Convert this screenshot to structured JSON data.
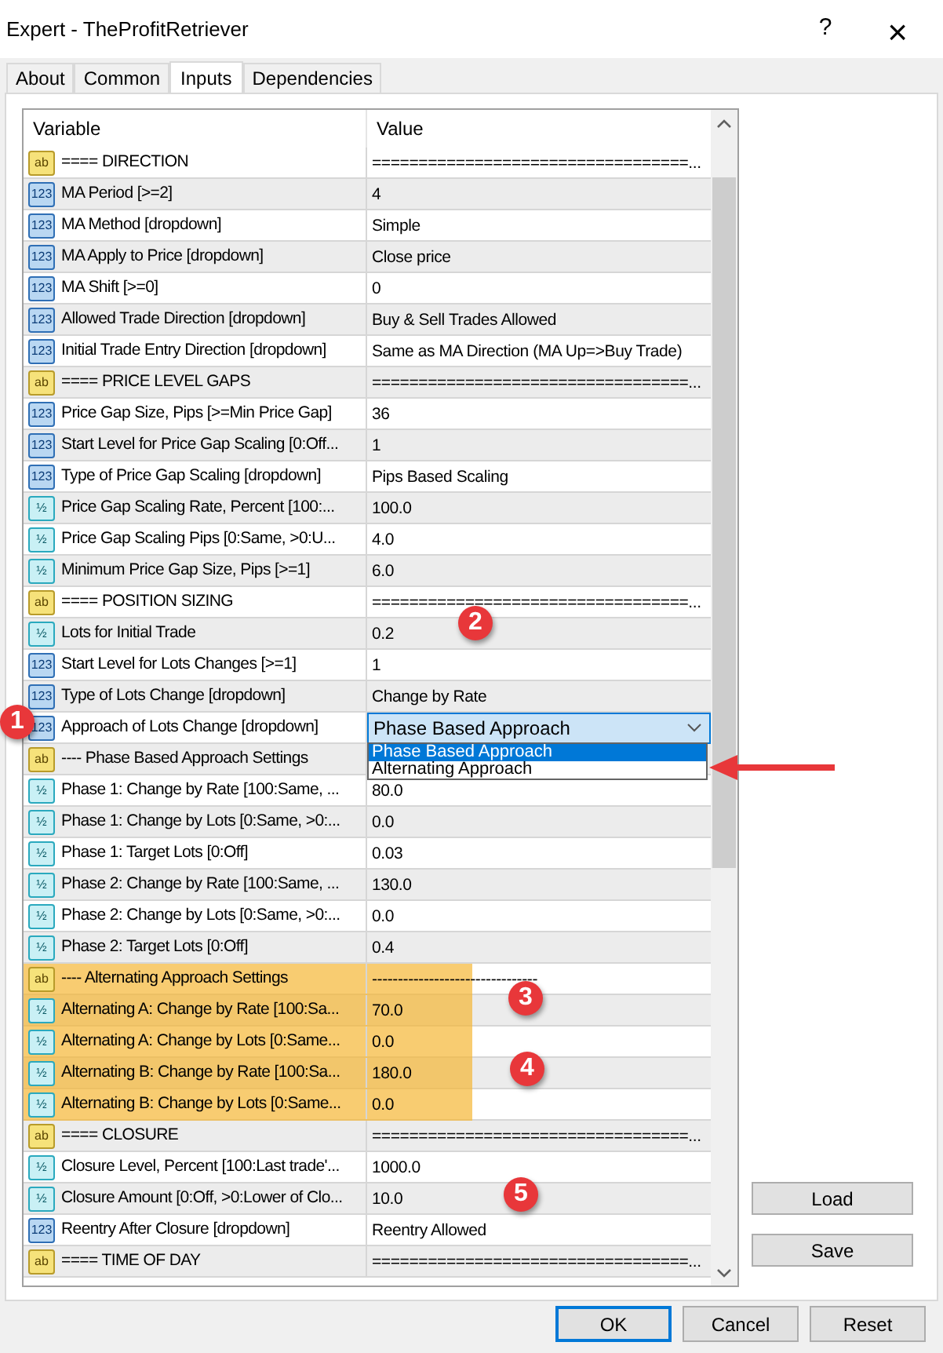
{
  "window": {
    "title": "Expert - TheProfitRetriever",
    "help": "?",
    "close": "×"
  },
  "tabs": [
    {
      "label": "About",
      "selected": false
    },
    {
      "label": "Common",
      "selected": false
    },
    {
      "label": "Inputs",
      "selected": true
    },
    {
      "label": "Dependencies",
      "selected": false
    }
  ],
  "table": {
    "columns": [
      "Variable",
      "Value"
    ],
    "rows": [
      {
        "kind": "string",
        "icon": "ab",
        "variable": "==== DIRECTION",
        "value": "==================================..."
      },
      {
        "kind": "int",
        "icon": "123",
        "variable": "MA Period [>=2]",
        "value": "4"
      },
      {
        "kind": "int",
        "icon": "123",
        "variable": "MA Method [dropdown]",
        "value": "Simple"
      },
      {
        "kind": "int",
        "icon": "123",
        "variable": "MA Apply to Price [dropdown]",
        "value": "Close price"
      },
      {
        "kind": "int",
        "icon": "123",
        "variable": "MA Shift [>=0]",
        "value": "0"
      },
      {
        "kind": "int",
        "icon": "123",
        "variable": "Allowed Trade Direction [dropdown]",
        "value": "Buy & Sell Trades Allowed"
      },
      {
        "kind": "int",
        "icon": "123",
        "variable": "Initial Trade Entry Direction [dropdown]",
        "value": "Same as MA Direction (MA Up=>Buy Trade)"
      },
      {
        "kind": "string",
        "icon": "ab",
        "variable": "==== PRICE LEVEL GAPS",
        "value": "==================================..."
      },
      {
        "kind": "int",
        "icon": "123",
        "variable": "Price Gap Size, Pips [>=Min Price Gap]",
        "value": "36"
      },
      {
        "kind": "int",
        "icon": "123",
        "variable": "Start Level for Price Gap Scaling [0:Off...",
        "value": "1"
      },
      {
        "kind": "int",
        "icon": "123",
        "variable": "Type of Price Gap Scaling [dropdown]",
        "value": "Pips Based Scaling"
      },
      {
        "kind": "double",
        "icon": "½",
        "variable": "Price Gap Scaling Rate, Percent [100:...",
        "value": "100.0"
      },
      {
        "kind": "double",
        "icon": "½",
        "variable": "Price Gap Scaling Pips [0:Same, >0:U...",
        "value": "4.0"
      },
      {
        "kind": "double",
        "icon": "½",
        "variable": "Minimum Price Gap Size, Pips [>=1]",
        "value": "6.0"
      },
      {
        "kind": "string",
        "icon": "ab",
        "variable": "==== POSITION SIZING",
        "value": "==================================..."
      },
      {
        "kind": "double",
        "icon": "½",
        "variable": "Lots for Initial Trade",
        "value": "0.2"
      },
      {
        "kind": "int",
        "icon": "123",
        "variable": "Start Level for Lots Changes [>=1]",
        "value": "1"
      },
      {
        "kind": "int",
        "icon": "123",
        "variable": "Type of Lots Change [dropdown]",
        "value": "Change by Rate"
      },
      {
        "kind": "int",
        "icon": "123",
        "variable": "Approach of Lots Change [dropdown]",
        "value": "Phase Based Approach",
        "dropdown": {
          "options": [
            {
              "label": "Phase Based Approach",
              "selected": true
            },
            {
              "label": "Alternating Approach",
              "selected": false
            }
          ]
        }
      },
      {
        "kind": "string",
        "icon": "ab",
        "variable": "---- Phase Based Approach Settings"
      },
      {
        "kind": "double",
        "icon": "½",
        "variable": "Phase 1: Change by Rate [100:Same, ...",
        "value": "80.0"
      },
      {
        "kind": "double",
        "icon": "½",
        "variable": "Phase 1: Change by Lots [0:Same, >0:...",
        "value": "0.0"
      },
      {
        "kind": "double",
        "icon": "½",
        "variable": "Phase 1: Target Lots [0:Off]",
        "value": "0.03"
      },
      {
        "kind": "double",
        "icon": "½",
        "variable": "Phase 2: Change by Rate [100:Same, ...",
        "value": "130.0"
      },
      {
        "kind": "double",
        "icon": "½",
        "variable": "Phase 2: Change by Lots [0:Same, >0:...",
        "value": "0.0"
      },
      {
        "kind": "double",
        "icon": "½",
        "variable": "Phase 2: Target Lots [0:Off]",
        "value": "0.4"
      },
      {
        "kind": "string",
        "icon": "ab",
        "variable": "---- Alternating Approach Settings",
        "value": "--------------------------------",
        "highlighted": true
      },
      {
        "kind": "double",
        "icon": "½",
        "variable": "Alternating A: Change by Rate [100:Sa...",
        "value": "70.0",
        "highlighted": true
      },
      {
        "kind": "double",
        "icon": "½",
        "variable": "Alternating A: Change by Lots [0:Same...",
        "value": "0.0",
        "highlighted": true
      },
      {
        "kind": "double",
        "icon": "½",
        "variable": "Alternating B: Change by Rate [100:Sa...",
        "value": "180.0",
        "highlighted": true
      },
      {
        "kind": "double",
        "icon": "½",
        "variable": "Alternating B: Change by Lots [0:Same...",
        "value": "0.0",
        "highlighted": true
      },
      {
        "kind": "string",
        "icon": "ab",
        "variable": "==== CLOSURE",
        "value": "==================================..."
      },
      {
        "kind": "double",
        "icon": "½",
        "variable": "Closure Level, Percent [100:Last trade'...",
        "value": "1000.0"
      },
      {
        "kind": "double",
        "icon": "½",
        "variable": "Closure Amount [0:Off, >0:Lower of Clo...",
        "value": "10.0"
      },
      {
        "kind": "int",
        "icon": "123",
        "variable": "Reentry After Closure [dropdown]",
        "value": "Reentry Allowed"
      },
      {
        "kind": "string",
        "icon": "ab",
        "variable": "==== TIME OF DAY",
        "value": "==================================..."
      }
    ]
  },
  "markers": [
    {
      "label": "1"
    },
    {
      "label": "2"
    },
    {
      "label": "3"
    },
    {
      "label": "4"
    },
    {
      "label": "5"
    }
  ],
  "side_buttons": [
    "Load",
    "Save"
  ],
  "buttons": [
    {
      "label": "OK",
      "default": true
    },
    {
      "label": "Cancel",
      "default": false
    },
    {
      "label": "Reset",
      "default": false
    }
  ]
}
